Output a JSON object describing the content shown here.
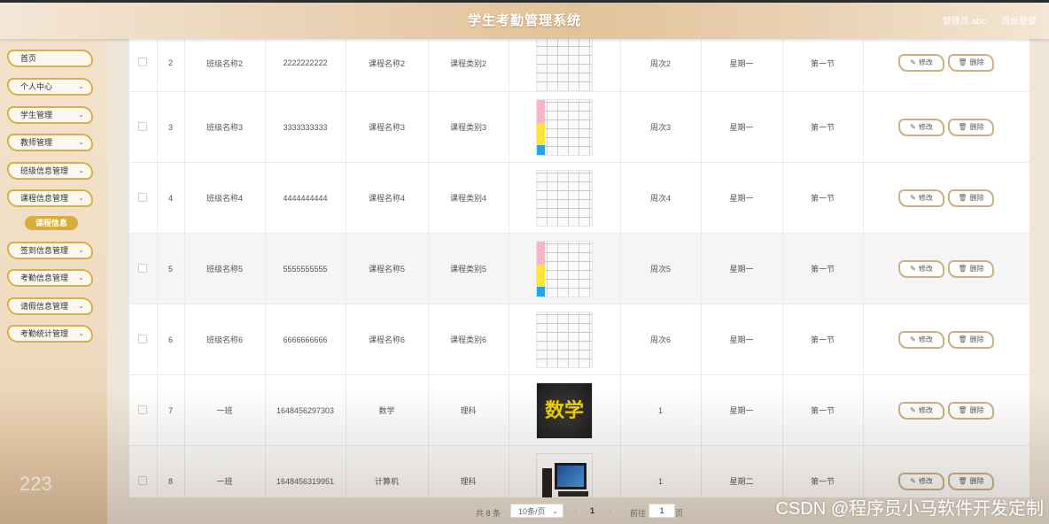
{
  "header": {
    "title": "学生考勤管理系统",
    "user": "管理员 abo",
    "logout": "退出登录"
  },
  "sidebar": {
    "items": [
      {
        "label": "首页",
        "chevron": ""
      },
      {
        "label": "个人中心",
        "chevron": "⌄"
      },
      {
        "label": "学生管理",
        "chevron": "⌄"
      },
      {
        "label": "教师管理",
        "chevron": "⌄"
      },
      {
        "label": "班级信息管理",
        "chevron": "⌄"
      },
      {
        "label": "课程信息管理",
        "chevron": "⌄"
      },
      {
        "label": "签到信息管理",
        "chevron": "⌄"
      },
      {
        "label": "考勤信息管理",
        "chevron": "⌄"
      },
      {
        "label": "请假信息管理",
        "chevron": "⌄"
      },
      {
        "label": "考勤统计管理",
        "chevron": "⌄"
      }
    ],
    "active_sub": "课程信息",
    "bottom_text": "223"
  },
  "table": {
    "rows": [
      {
        "index": "2",
        "class_name": "班级名称2",
        "course_no": "2222222222",
        "course_name": "课程名称2",
        "course_type": "课程类别2",
        "image": "schedule",
        "week": "周次2",
        "weekday": "星期一",
        "section": "第一节"
      },
      {
        "index": "3",
        "class_name": "班级名称3",
        "course_no": "3333333333",
        "course_name": "课程名称3",
        "course_type": "课程类别3",
        "image": "schedule-color",
        "week": "周次3",
        "weekday": "星期一",
        "section": "第一节"
      },
      {
        "index": "4",
        "class_name": "班级名称4",
        "course_no": "4444444444",
        "course_name": "课程名称4",
        "course_type": "课程类别4",
        "image": "schedule",
        "week": "周次4",
        "weekday": "星期一",
        "section": "第一节"
      },
      {
        "index": "5",
        "class_name": "班级名称5",
        "course_no": "5555555555",
        "course_name": "课程名称5",
        "course_type": "课程类别5",
        "image": "schedule-color",
        "week": "周次5",
        "weekday": "星期一",
        "section": "第一节"
      },
      {
        "index": "6",
        "class_name": "班级名称6",
        "course_no": "6666666666",
        "course_name": "课程名称6",
        "course_type": "课程类别6",
        "image": "schedule",
        "week": "周次6",
        "weekday": "星期一",
        "section": "第一节"
      },
      {
        "index": "7",
        "class_name": "一班",
        "course_no": "1648456297303",
        "course_name": "数学",
        "course_type": "理科",
        "image": "math",
        "image_text": "数学",
        "week": "1",
        "weekday": "星期一",
        "section": "第一节"
      },
      {
        "index": "8",
        "class_name": "一班",
        "course_no": "1648456319951",
        "course_name": "计算机",
        "course_type": "理科",
        "image": "computer",
        "week": "1",
        "weekday": "星期二",
        "section": "第一节"
      }
    ],
    "edit_label": "修改",
    "delete_label": "删除",
    "edit_icon": "✎",
    "delete_icon": "🗑"
  },
  "pagination": {
    "total": "共 8 条",
    "page_size": "10条/页",
    "prev": "‹",
    "current": "1",
    "next": "›",
    "goto_label": "前往",
    "goto_value": "1",
    "goto_unit": "页"
  },
  "watermark": "CSDN @程序员小马软件开发定制"
}
